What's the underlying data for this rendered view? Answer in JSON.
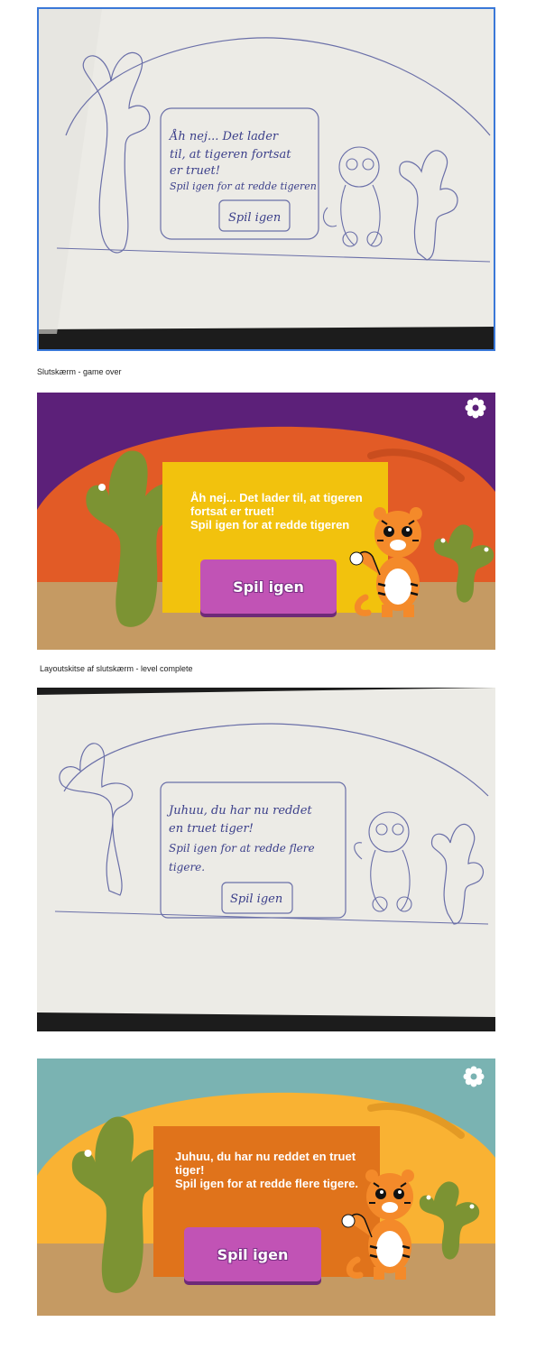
{
  "sketch_game_over": {
    "lines": [
      "Åh nej... Det lader",
      "til, at tigeren fortsat",
      "er truet!",
      "Spil igen for at redde tigeren"
    ],
    "button": "Spil igen"
  },
  "caption_game_over": "Slutskærm - game over",
  "screen_game_over": {
    "message": "Åh nej... Det lader til, at tigeren fortsat er truet!\nSpil igen for at redde tigeren",
    "button": "Spil igen",
    "colors": {
      "sky": "#5c2079",
      "hill": "#e25b26",
      "ground": "#c59a63",
      "box": "#f2c20d",
      "button": "#c153b5"
    }
  },
  "caption_level_complete": "Layoutskitse af slutskærm - level complete",
  "sketch_level_complete": {
    "lines": [
      "Juhuu, du har nu reddet",
      "en truet tiger!",
      "Spil igen for at redde flere",
      "tigere."
    ],
    "button": "Spil igen"
  },
  "screen_level_complete": {
    "message": "Juhuu, du har nu reddet en truet tiger!\nSpil igen for at redde flere tigere.",
    "button": "Spil igen",
    "colors": {
      "sky": "#7ab3b2",
      "hill": "#f9b233",
      "ground": "#c59a63",
      "box": "#e0731b",
      "button": "#c153b5"
    }
  },
  "icons": {
    "settings": "gear-icon",
    "tiger": "tiger-icon",
    "cactus": "cactus-icon"
  }
}
